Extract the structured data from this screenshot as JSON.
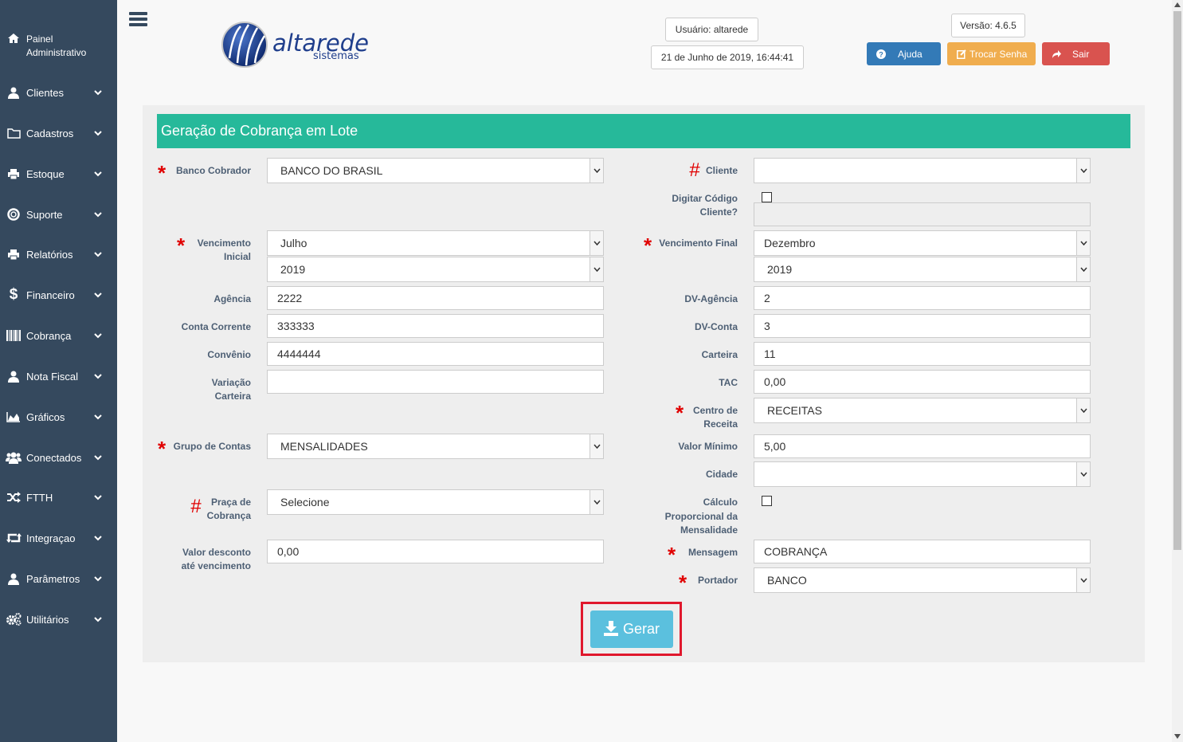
{
  "sidebar": {
    "items": [
      {
        "label": "Painel Administrativo",
        "icon": "home-icon"
      },
      {
        "label": "Clientes",
        "icon": "user-icon"
      },
      {
        "label": "Cadastros",
        "icon": "folder-icon"
      },
      {
        "label": "Estoque",
        "icon": "printer-icon"
      },
      {
        "label": "Suporte",
        "icon": "lifebuoy-icon"
      },
      {
        "label": "Relatórios",
        "icon": "printer-icon"
      },
      {
        "label": "Financeiro",
        "icon": "dollar-icon"
      },
      {
        "label": "Cobrança",
        "icon": "barcode-icon"
      },
      {
        "label": "Nota Fiscal",
        "icon": "user-icon"
      },
      {
        "label": "Gráficos",
        "icon": "area-chart-icon"
      },
      {
        "label": "Conectados",
        "icon": "users-icon"
      },
      {
        "label": "FTTH",
        "icon": "random-icon"
      },
      {
        "label": "Integraçao",
        "icon": "retweet-icon"
      },
      {
        "label": "Parâmetros",
        "icon": "user-icon"
      },
      {
        "label": "Utilitários",
        "icon": "cogs-icon"
      }
    ]
  },
  "header": {
    "logo_main": "altarede",
    "logo_sub": "sistemas",
    "user": "Usuário: altarede",
    "datetime": "21 de Junho de 2019, 16:44:41",
    "version": "Versão: 4.6.5",
    "help_label": "Ajuda",
    "change_password_label": "Trocar Senha",
    "logout_label": "Sair",
    "colors": {
      "help": "#337ab7",
      "change_password": "#f0ad4e",
      "logout": "#d9534f"
    }
  },
  "form": {
    "title": "Geração de Cobrança em Lote",
    "left": {
      "banco_cobrador": {
        "label": "Banco Cobrador",
        "value": "BANCO DO BRASIL"
      },
      "vencimento_inicial": {
        "label1": "Vencimento",
        "label2": "Inicial",
        "month": "Julho",
        "year": "2019"
      },
      "agencia": {
        "label": "Agência",
        "value": "2222"
      },
      "conta_corrente": {
        "label": "Conta Corrente",
        "value": "333333"
      },
      "convenio": {
        "label": "Convênio",
        "value": "4444444"
      },
      "variacao_carteira": {
        "label1": "Variação",
        "label2": "Carteira",
        "value": ""
      },
      "grupo_contas": {
        "label": "Grupo de Contas",
        "value": "MENSALIDADES"
      },
      "praca_cobranca": {
        "label1": "Praça de",
        "label2": "Cobrança",
        "value": "Selecione"
      },
      "valor_desconto": {
        "label1": "Valor desconto",
        "label2": "até vencimento",
        "value": "0,00"
      }
    },
    "right": {
      "cliente": {
        "label": "Cliente",
        "value": ""
      },
      "digitar_codigo": {
        "label1": "Digitar Código",
        "label2": "Cliente?",
        "value": ""
      },
      "vencimento_final": {
        "label": "Vencimento Final",
        "month": "Dezembro",
        "year": "2019"
      },
      "dv_agencia": {
        "label": "DV-Agência",
        "value": "2"
      },
      "dv_conta": {
        "label": "DV-Conta",
        "value": "3"
      },
      "carteira": {
        "label": "Carteira",
        "value": "11"
      },
      "tac": {
        "label": "TAC",
        "value": "0,00"
      },
      "centro_receita": {
        "label1": "Centro de",
        "label2": "Receita",
        "value": "RECEITAS"
      },
      "valor_minimo": {
        "label": "Valor Mínimo",
        "value": "5,00"
      },
      "cidade": {
        "label": "Cidade",
        "value": ""
      },
      "calculo_proporcional": {
        "label1": "Cálculo",
        "label2": "Proporcional da",
        "label3": "Mensalidade"
      },
      "mensagem": {
        "label": "Mensagem",
        "value": "COBRANÇA"
      },
      "portador": {
        "label": "Portador",
        "value": "BANCO"
      }
    },
    "submit_label": "Gerar",
    "accent_color": "#26b99a",
    "required_marker": "*",
    "optional_marker": "#"
  }
}
